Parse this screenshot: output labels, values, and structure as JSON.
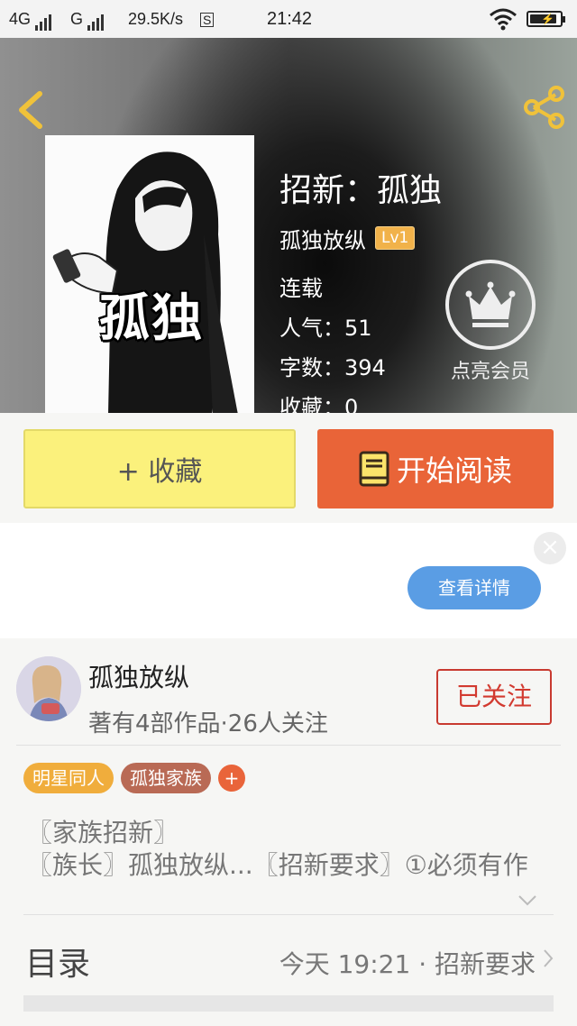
{
  "status_bar": {
    "net1": "4G",
    "net2": "G",
    "speed": "29.5K/s",
    "time": "21:42",
    "battery_level": 0.9
  },
  "header": {
    "cover_text": "孤独",
    "title": "招新：孤独",
    "author": "孤独放纵",
    "level": "Lv1",
    "status": "连载",
    "popularity": "人气：51",
    "word_count": "字数：394",
    "favorites": "收藏：0",
    "vip_label": "点亮会员"
  },
  "actions": {
    "favorite_label": "+ 收藏",
    "read_label": "开始阅读"
  },
  "ad": {
    "close_symbol": "×",
    "detail_label": "查看详情"
  },
  "author_card": {
    "name": "孤独放纵",
    "meta": "著有4部作品·26人关注",
    "follow_label": "已关注",
    "tags": [
      "明星同人",
      "孤独家族"
    ],
    "tag_colors": [
      "#f0ad3c",
      "#b96a55"
    ],
    "tag_add": "+",
    "desc_line1": "〖家族招新〗",
    "desc_line2": "〖族长〗孤独放纵...〖招新要求〗①必须有作"
  },
  "toc": {
    "label": "目录",
    "latest": "今天 19:21 · 招新要求"
  }
}
